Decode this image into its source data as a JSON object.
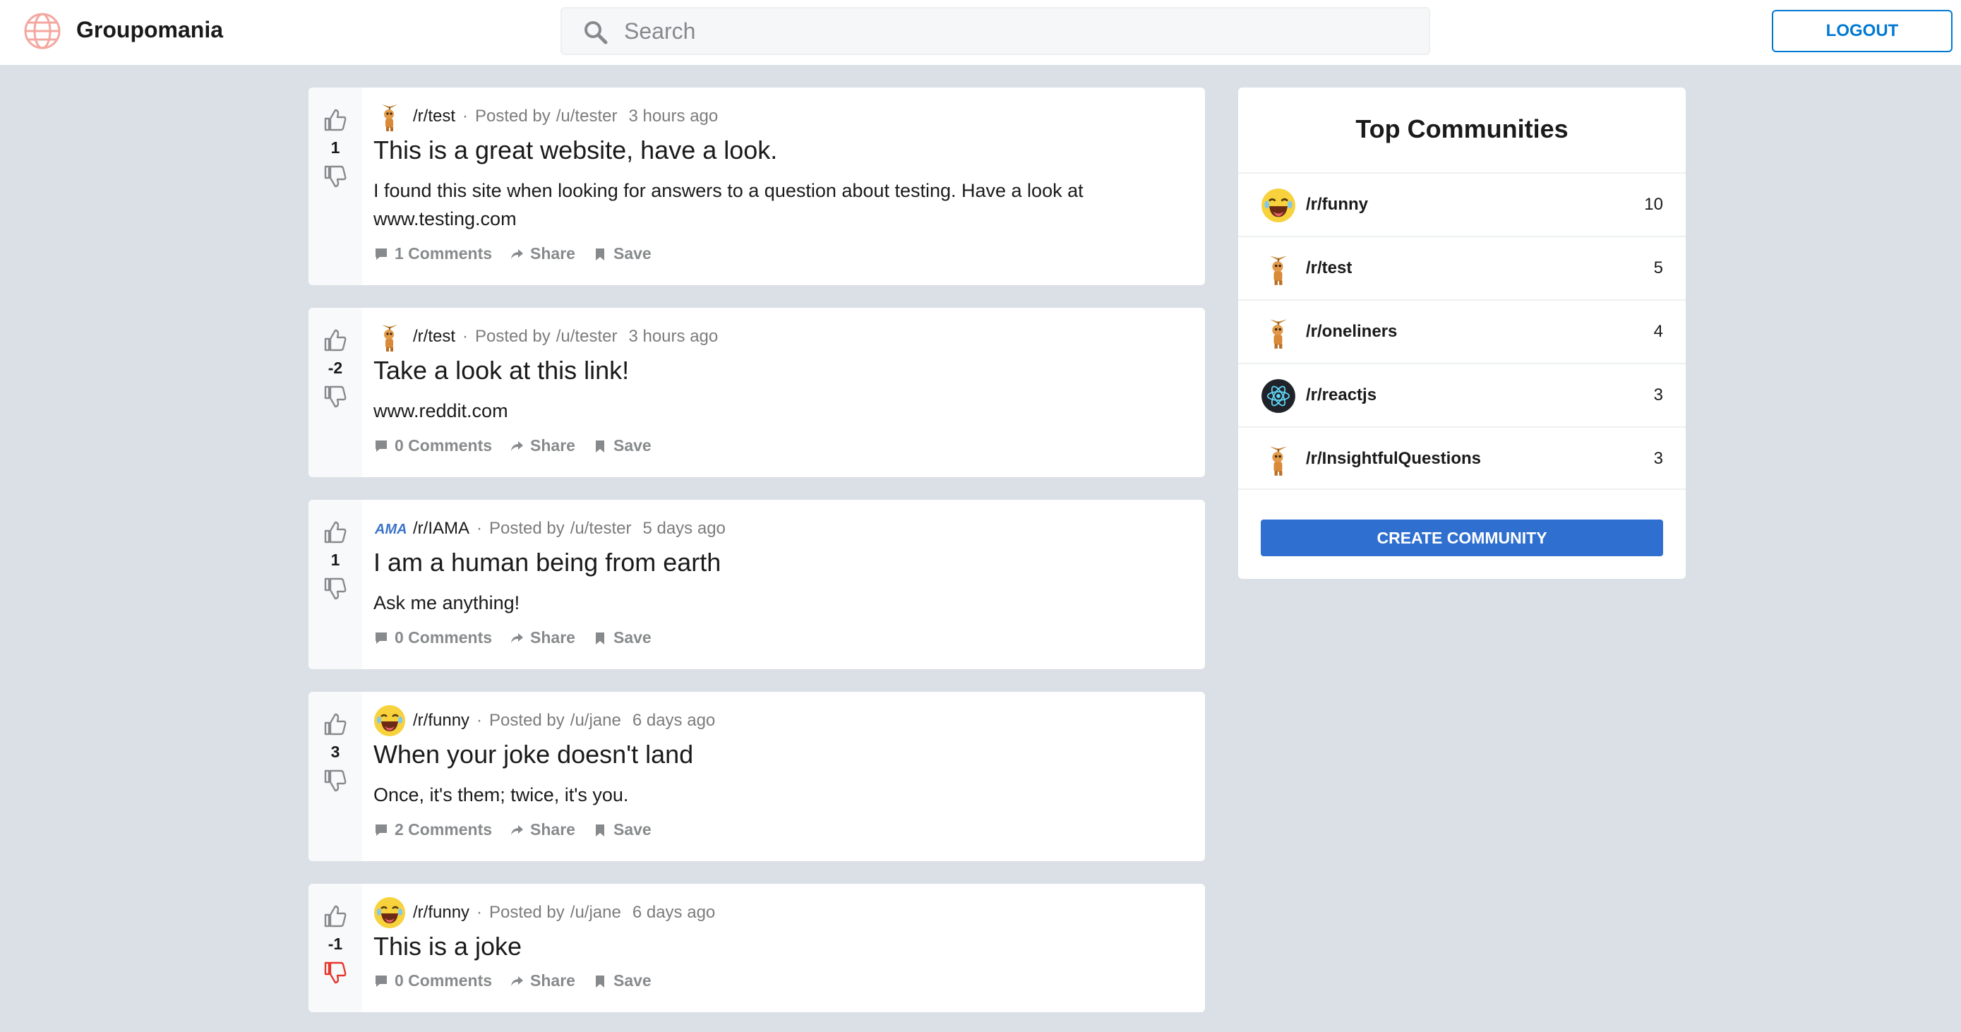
{
  "app": {
    "brand": "Groupomania",
    "logo_icon": "globe-icon"
  },
  "header": {
    "search_placeholder": "Search",
    "logout_label": "LOGOUT"
  },
  "posts": [
    {
      "community": "/r/test",
      "community_icon": "wooden-figure-icon",
      "posted_by": "Posted by",
      "user": "/u/tester",
      "time": "3 hours ago",
      "score": "1",
      "vote_state": "none",
      "title": "This is a great website, have a look.",
      "text": "I found this site when looking for answers to a question about testing. Have a look at www.testing.com",
      "comments": "1 Comments",
      "share": "Share",
      "save": "Save"
    },
    {
      "community": "/r/test",
      "community_icon": "wooden-figure-icon",
      "posted_by": "Posted by",
      "user": "/u/tester",
      "time": "3 hours ago",
      "score": "-2",
      "vote_state": "none",
      "title": "Take a look at this link!",
      "text": "www.reddit.com",
      "comments": "0 Comments",
      "share": "Share",
      "save": "Save"
    },
    {
      "community": "/r/IAMA",
      "community_icon": "ama-logo-icon",
      "posted_by": "Posted by",
      "user": "/u/tester",
      "time": "5 days ago",
      "score": "1",
      "vote_state": "none",
      "title": "I am a human being from earth",
      "text": "Ask me anything!",
      "comments": "0 Comments",
      "share": "Share",
      "save": "Save"
    },
    {
      "community": "/r/funny",
      "community_icon": "laughing-emoji-icon",
      "posted_by": "Posted by",
      "user": "/u/jane",
      "time": "6 days ago",
      "score": "3",
      "vote_state": "none",
      "title": "When your joke doesn't land",
      "text": "Once, it's them; twice, it's you.",
      "comments": "2 Comments",
      "share": "Share",
      "save": "Save"
    },
    {
      "community": "/r/funny",
      "community_icon": "laughing-emoji-icon",
      "posted_by": "Posted by",
      "user": "/u/jane",
      "time": "6 days ago",
      "score": "-1",
      "vote_state": "down",
      "title": "This is a joke",
      "text": "",
      "comments": "0 Comments",
      "share": "Share",
      "save": "Save"
    }
  ],
  "sidebar": {
    "title": "Top Communities",
    "communities": [
      {
        "name": "/r/funny",
        "count": "10",
        "icon": "laughing-emoji-icon"
      },
      {
        "name": "/r/test",
        "count": "5",
        "icon": "wooden-figure-icon"
      },
      {
        "name": "/r/oneliners",
        "count": "4",
        "icon": "wooden-figure-icon"
      },
      {
        "name": "/r/reactjs",
        "count": "3",
        "icon": "react-atom-icon"
      },
      {
        "name": "/r/InsightfulQuestions",
        "count": "3",
        "icon": "wooden-figure-icon"
      }
    ],
    "create_label": "CREATE COMMUNITY"
  },
  "colors": {
    "accent": "#0079d3",
    "create_button": "#2f6fd0",
    "downvote_active": "#e5372d",
    "background": "#dae0e6"
  }
}
